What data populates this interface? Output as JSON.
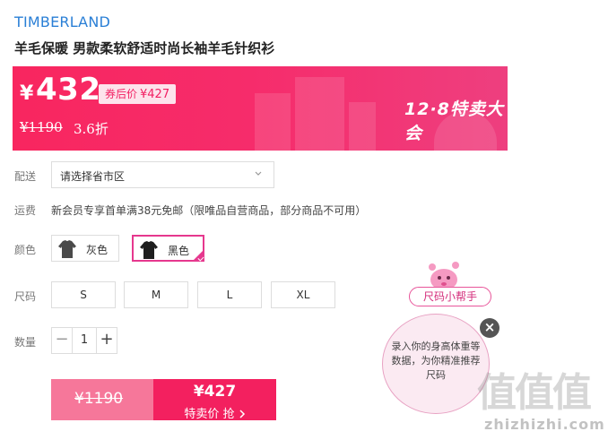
{
  "product": {
    "brand": "TIMBERLAND",
    "title": "羊毛保暖 男款柔软舒适时尚长袖羊毛针织衫"
  },
  "price_banner": {
    "currency": "¥",
    "price": "432",
    "coupon_label": "券后价",
    "coupon_price": "¥427",
    "original_price": "¥1190",
    "discount": "3.6折",
    "event_text": "12·8特卖大会",
    "colors": {
      "start": "#f8265f",
      "end": "#ee3f7f"
    }
  },
  "delivery": {
    "label": "配送",
    "select_value": "请选择省市区"
  },
  "shipping": {
    "label": "运费",
    "text": "新会员专享首单满38元免邮（限唯品自营商品，部分商品不可用）"
  },
  "color": {
    "label": "颜色",
    "options": [
      {
        "label": "灰色",
        "selected": false,
        "swatch": "#4a4a4a"
      },
      {
        "label": "黑色",
        "selected": true,
        "swatch": "#1e1e1e"
      }
    ],
    "accent": "#e6388e"
  },
  "size": {
    "label": "尺码",
    "options": [
      "S",
      "M",
      "L",
      "XL"
    ]
  },
  "quantity": {
    "label": "数量",
    "value": "1",
    "minus": "−",
    "plus": "+"
  },
  "buy_button": {
    "original_price": "¥1190",
    "price": "¥427",
    "cta": "特卖价 抢",
    "arrow_icon": "chevron-right-icon"
  },
  "size_helper": {
    "pill_label": "尺码小帮手",
    "bubble_text": "录入你的身高体重等数据，为你精准推荐尺码",
    "close_icon": "close-icon"
  },
  "watermark": {
    "big": "值值值",
    "small": "zhizhizhi.com"
  }
}
